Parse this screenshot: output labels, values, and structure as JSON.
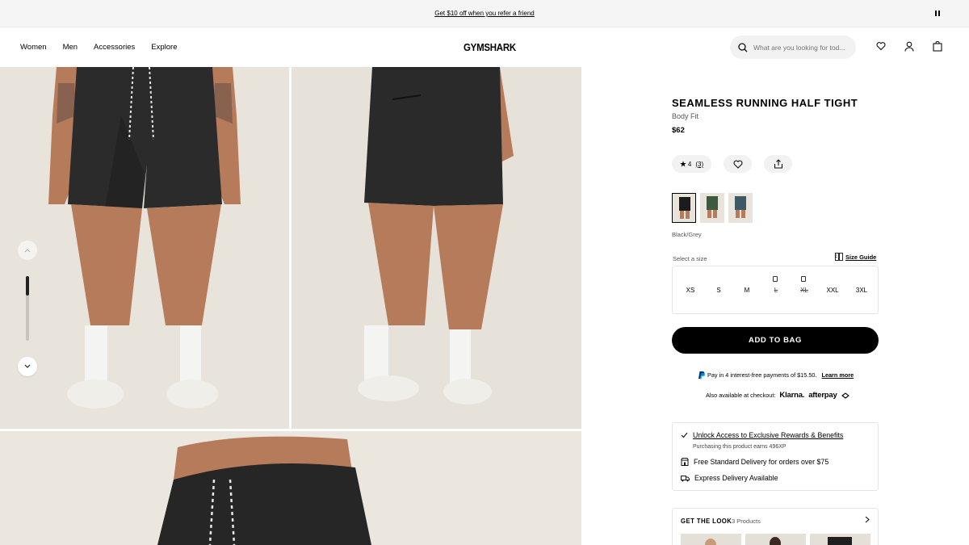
{
  "promo": {
    "text": "Get $10 off when you refer a friend"
  },
  "header": {
    "nav": [
      "Women",
      "Men",
      "Accessories",
      "Explore"
    ],
    "logo": "GYMSHARK",
    "search_placeholder": "What are you looking for tod..."
  },
  "product": {
    "title": "SEAMLESS RUNNING HALF TIGHT",
    "fit": "Body Fit",
    "price": "$62",
    "rating": "4",
    "review_count": "(3)",
    "colour_name": "Black/Grey",
    "swatches": [
      {
        "name": "black-grey",
        "color": "#1c1c1c"
      },
      {
        "name": "green",
        "color": "#3b5a3f"
      },
      {
        "name": "blue",
        "color": "#3f5866"
      }
    ],
    "size_label": "Select a size",
    "size_guide": "Size Guide",
    "sizes": [
      {
        "label": "XS",
        "available": true
      },
      {
        "label": "S",
        "available": true
      },
      {
        "label": "M",
        "available": true
      },
      {
        "label": "L",
        "available": false
      },
      {
        "label": "XL",
        "available": false
      },
      {
        "label": "XXL",
        "available": true
      },
      {
        "label": "3XL",
        "available": true
      }
    ],
    "add_to_bag": "ADD TO BAG",
    "paypal_text": "Pay in 4 interest-free payments of $15.50.",
    "paypal_link": "Learn more",
    "also_available": "Also available at checkout:",
    "klarna": "Klarna.",
    "afterpay": "afterpay"
  },
  "benefits": {
    "rewards_title": "Unlock Access to Exclusive Rewards & Benefits",
    "rewards_sub": "Purchasing this product earns 496XP",
    "delivery": "Free Standard Delivery for orders over $75",
    "express": "Express Delivery Available"
  },
  "get_the_look": {
    "title": "GET THE LOOK",
    "count": "3 Products"
  },
  "colors": {
    "accent": "#000000",
    "pill_bg": "#f2f2f2",
    "promo_bg": "#f5f5f5"
  }
}
